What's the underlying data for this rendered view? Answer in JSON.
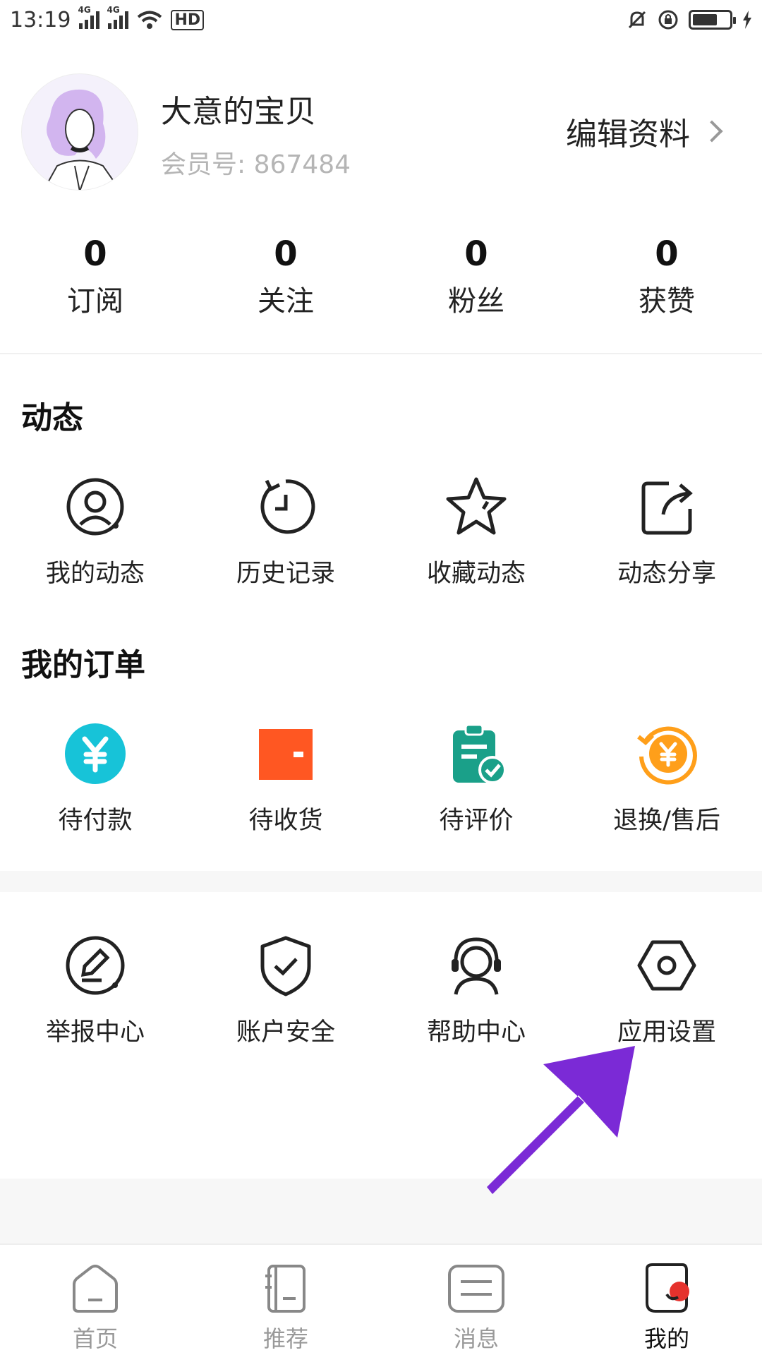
{
  "status_bar": {
    "time": "13:19",
    "network1": "4G",
    "network2": "4G",
    "hd": "HD"
  },
  "profile": {
    "username": "大意的宝贝",
    "member_label": "会员号:",
    "member_number": "867484",
    "edit_label": "编辑资料"
  },
  "stats": [
    {
      "value": "0",
      "label": "订阅"
    },
    {
      "value": "0",
      "label": "关注"
    },
    {
      "value": "0",
      "label": "粉丝"
    },
    {
      "value": "0",
      "label": "获赞"
    }
  ],
  "dynamics": {
    "title": "动态",
    "items": [
      {
        "label": "我的动态",
        "icon": "user-circle-icon"
      },
      {
        "label": "历史记录",
        "icon": "history-clock-icon"
      },
      {
        "label": "收藏动态",
        "icon": "star-icon"
      },
      {
        "label": "动态分享",
        "icon": "share-icon"
      }
    ]
  },
  "orders": {
    "title": "我的订单",
    "items": [
      {
        "label": "待付款",
        "icon": "yen-circle-icon",
        "color": "#17c3d8"
      },
      {
        "label": "待收货",
        "icon": "wallet-icon",
        "color": "#ff5722"
      },
      {
        "label": "待评价",
        "icon": "clipboard-check-icon",
        "color": "#1aa089"
      },
      {
        "label": "退换/售后",
        "icon": "refund-yen-icon",
        "color": "#ff9f1a"
      }
    ]
  },
  "services": {
    "items": [
      {
        "label": "举报中心",
        "icon": "report-pen-icon"
      },
      {
        "label": "账户安全",
        "icon": "shield-check-icon"
      },
      {
        "label": "帮助中心",
        "icon": "headset-icon"
      },
      {
        "label": "应用设置",
        "icon": "hexagon-settings-icon"
      }
    ]
  },
  "tabbar": [
    {
      "label": "首页",
      "icon": "home-icon",
      "active": false
    },
    {
      "label": "推荐",
      "icon": "notebook-icon",
      "active": false
    },
    {
      "label": "消息",
      "icon": "message-icon",
      "active": false
    },
    {
      "label": "我的",
      "icon": "profile-icon",
      "active": true
    }
  ],
  "annotation": {
    "color": "#7b2ad6"
  }
}
